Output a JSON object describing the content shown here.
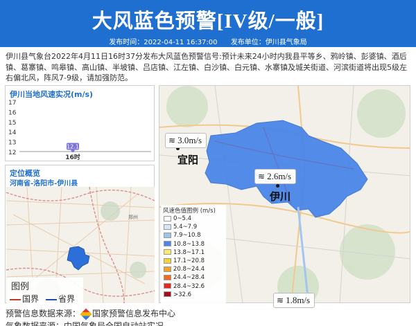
{
  "header": {
    "title": "大风蓝色预警[IV级/一般]",
    "publish_time_label": "发布时间：2022-04-11 16:37:00",
    "publish_unit_label": "发布单位：伊川县气象局",
    "background_color": "#1f6fd0"
  },
  "description": "伊川县气象台2022年4月11日16时37分发布大风蓝色预警信号:预计未来24小时内我县平等乡、鸦岭镇、彭婆镇、酒后镇、葛寨镇、鸣皋镇、高山镇、半坡镇、吕店镇、江左镇、白沙镇、白元镇、水寨镇及城关街道、河滨街道将出现5级左右偏北风，阵风7-9级，请加强防范。",
  "wind_panel": {
    "title": "伊川当地风速实况(m/s)",
    "chart_data": {
      "type": "scatter",
      "x": [
        "16时"
      ],
      "values": [
        12.1
      ],
      "y_ticks": [
        17,
        16,
        15,
        14,
        13,
        12
      ],
      "ylim": [
        12,
        17
      ],
      "point_label": "12.1",
      "color": "#7b74d9"
    }
  },
  "location_panel": {
    "title": "定位概览",
    "path": "河南省-洛阳市-伊川县",
    "legend": {
      "title": "图例",
      "items": [
        {
          "label": "国界",
          "color": "#c0392b"
        },
        {
          "label": "省界",
          "color": "#1f4fb0"
        }
      ]
    }
  },
  "main_map": {
    "wind_labels": [
      {
        "icon": "wind-icon",
        "value": "3.0m/s"
      },
      {
        "icon": "wind-icon",
        "value": "2.6m/s"
      },
      {
        "icon": "wind-icon",
        "value": "1.8m/s"
      }
    ],
    "cities": [
      "宜阳",
      "伊川"
    ],
    "region_color": "#4a86e8",
    "scale": {
      "title": "风速色值图例 (m/s)",
      "items": [
        {
          "label": "0~5.4",
          "color": "#ffffff"
        },
        {
          "label": "5.4~7.9",
          "color": "#d6e6f7"
        },
        {
          "label": "7.9~10.8",
          "color": "#9fc5ef"
        },
        {
          "label": "10.8~13.8",
          "color": "#4a86e8"
        },
        {
          "label": "13.8~17.1",
          "color": "#f7ec6a"
        },
        {
          "label": "17.1~20.8",
          "color": "#f3d13a"
        },
        {
          "label": "20.8~24.4",
          "color": "#f2a32b"
        },
        {
          "label": "24.4~28.4",
          "color": "#ef6b21"
        },
        {
          "label": "28.4~32.6",
          "color": "#e12b1f"
        },
        {
          "label": ">32.6",
          "color": "#a0101a"
        }
      ]
    }
  },
  "footer": {
    "source_label": "预警信息数据来源：",
    "source_name": "国家预警信息发布中心",
    "line2": "气象数据来源：中国气象局全国自动站实况"
  }
}
